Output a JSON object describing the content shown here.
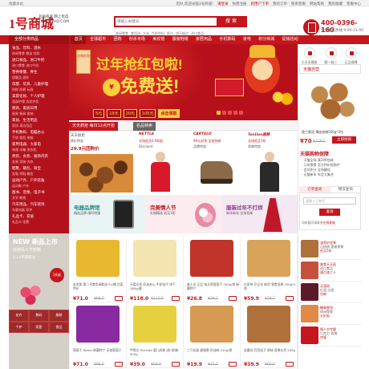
{
  "topbar": {
    "favorite": "收藏本站",
    "links": [
      "您好,欢迎光临1号商城!",
      "请登录",
      "免费注册",
      "新用户下单",
      "免费注册",
      "我的订单",
      "联系客服",
      "网站帮助",
      "我的收藏",
      "客服中心",
      "帮助中心"
    ]
  },
  "header": {
    "logo": "1号商城",
    "logo_sub_1": "品质商城 网上优选",
    "logo_sub_2": "1MALL.YHD.COM",
    "search_placeholder": "请输入关键词",
    "search_button": "搜 索",
    "hotwords": [
      "休闲零食",
      "食用油",
      "大米",
      "牛奶饮料",
      "纸巾",
      "饼干糕点",
      "进口食品"
    ],
    "phone": "400-0396-160",
    "phone_sub": "全国服务热线 9:00-21:00"
  },
  "nav": {
    "all_categories": "全部分类商品",
    "items": [
      "首页",
      "全球超市",
      "团购",
      "秒杀专场",
      "美妆馆",
      "服装鞋帽",
      "家居用品",
      "手机数码",
      "家电",
      "积分商城",
      "促销活动",
      "更多"
    ]
  },
  "sidebar": [
    {
      "title": "食品、饮料、酒水",
      "sub": "休闲零食 粮油 饮料"
    },
    {
      "title": "进口食品、进口牛奶",
      "sub": "进口零食 进口牛奶"
    },
    {
      "title": "营养保健、养生",
      "sub": "保健品 滋补"
    },
    {
      "title": "母婴、玩具、儿童护理",
      "sub": "奶粉 尿裤 玩具"
    },
    {
      "title": "美容化妆、个人护理",
      "sub": "面部护理 洗发护发"
    },
    {
      "title": "厨具、家居日用",
      "sub": "厨具 餐具 收纳"
    },
    {
      "title": "家居、生活用品",
      "sub": "家纺 清洁用品"
    },
    {
      "title": "手机数码、电脑办公",
      "sub": "手机 相机 电脑"
    },
    {
      "title": "家用电器、大家电",
      "sub": "电视 冰箱 洗衣机"
    },
    {
      "title": "男装、女装、服饰内衣",
      "sub": "女装 男装 内衣"
    },
    {
      "title": "鞋靴、箱包、珠宝",
      "sub": "女鞋 男鞋 箱包"
    },
    {
      "title": "运动户外、户外装备",
      "sub": "运动鞋 户外"
    },
    {
      "title": "图书、音像、电子书",
      "sub": "文学 教育"
    },
    {
      "title": "汽车用品、汽车装饰",
      "sub": "车载电器 养护"
    },
    {
      "title": "礼品卡、充值",
      "sub": "礼品卡 话费"
    }
  ],
  "new_block": {
    "title": "NEW 新品上市",
    "sub": "完美情人节攻略",
    "sub2": "2.14不容错过",
    "badge": "1折起",
    "cats": [
      "花卉",
      "数码",
      "服装",
      "个护",
      "家居",
      "食品",
      "鞋包",
      "母婴",
      "美食"
    ]
  },
  "banner": {
    "tag": "过年红包",
    "title": "过年抢红包啦!",
    "big": "免费送!",
    "coin": "¥",
    "amounts": [
      "5元",
      "10元",
      "20元",
      "100元"
    ],
    "cta": "点击领取"
  },
  "deals": {
    "tab_a": "天天疯抢 每日12点开抢",
    "tab_b": "名品特卖",
    "left_title": "天天疯抢",
    "left_sub": "原价特卖",
    "left_price": "29.9元团购价",
    "cards": [
      {
        "label": "NETTLE",
        "deal": "全场低至0.9折起",
        "note": "Discount"
      },
      {
        "label": "CARTELO",
        "deal": "99元封顶 全场包邮",
        "note": "品牌特卖"
      },
      {
        "label": "Tonlion唐狮",
        "deal": "全场低至1折",
        "note": "男装特卖"
      }
    ]
  },
  "promos": [
    {
      "title": "电器品牌馆",
      "sub": "精选品牌 限时特惠",
      "color": "#2a8a8a"
    },
    {
      "title": "完美情人节",
      "sub": "礼物精选 低至1折",
      "color": "#c4161c"
    },
    {
      "title": "服装过年不打烊",
      "sub": "新年新衣 全场包邮",
      "color": "#8a3a8a"
    }
  ],
  "products": [
    {
      "name": "金龙鱼 第二代食用调和油 5L/桶 优惠特价",
      "price": "¥71.0",
      "old": "¥98.5",
      "color": "#e8b830"
    },
    {
      "name": "天喜乐优 奶油夹心 牛奶馅子 饼干 180g/盒",
      "price": "¥118.0",
      "old": "¥132.8",
      "color": "#f3e4b0"
    },
    {
      "name": "维士达 正品 纯天然葡萄干 500g/袋 新疆特产",
      "price": "¥26.8",
      "old": "¥39.2",
      "color": "#c0342a"
    },
    {
      "name": "亿家亲 巴旦木 新货 零食坚果 250g*2袋",
      "price": "¥59.9",
      "old": "¥79.2",
      "color": "#d9a35a"
    },
    {
      "name": "葡萄干 Raisin 新疆特产 无核葡萄干",
      "price": "¥71.0",
      "old": "¥98.0",
      "color": "#8a2aa0"
    },
    {
      "name": "甲骨文 Farmlab 婴儿奶粉 进口奶粉 900g",
      "price": "¥39.0",
      "old": "¥59.0",
      "color": "#e6d040"
    },
    {
      "name": "三只松鼠 碧根果 奶油味 210g/袋",
      "price": "¥19.9",
      "old": "¥32.0",
      "color": "#d69a52"
    },
    {
      "name": "金磨坊 巴西松子 原味 坚果炒货 200g",
      "price": "¥39.9",
      "old": "¥60.0",
      "color": "#b0703a"
    }
  ],
  "right": {
    "icons": [
      "七天无理由",
      "假一赔三",
      "正品保障"
    ],
    "tmall_label": "天猫自营",
    "walnut_name": "楼兰蜜语 薄皮核桃500g*3包",
    "walnut_price": "¥70",
    "walnut_old": "¥128.0",
    "walnut_buy": "立即抢购",
    "notice_title": "天猫购物保障",
    "notices": [
      "· 天猫全场 满199包邮",
      "· 万份零食 官方特价抢购中",
      "· 会员积分 全场翻倍",
      "· 天猫新年 年货大集合"
    ],
    "order_tabs": [
      "订单查询",
      "物流查询"
    ],
    "order_input": "请输入订单号",
    "order_btn": "查询",
    "order_tip_1": "如有疑问请联系",
    "order_tip_link": "在线客服",
    "order_tip_2": "或拨打客服电话",
    "order_tip_3": "订单中心",
    "list": [
      {
        "title": "温养护坚果",
        "d": "山核桃 夏威夷果",
        "p": "低至5折",
        "color": "#b0703a"
      },
      {
        "title": "美食天天逛",
        "d": "进口食品",
        "p": "满百减二十",
        "color": "#c4523a"
      },
      {
        "title": "买酒网",
        "d": "红酒 白酒",
        "p": "包邮",
        "color": "#5a1a2a"
      },
      {
        "title": "糖果蜜饯",
        "d": "休闲零食",
        "p": "五折起",
        "color": "#e08a4a"
      },
      {
        "title": "情人节专题",
        "d": "巧克力 玫瑰",
        "p": "特惠",
        "color": "#c4161c"
      }
    ]
  }
}
